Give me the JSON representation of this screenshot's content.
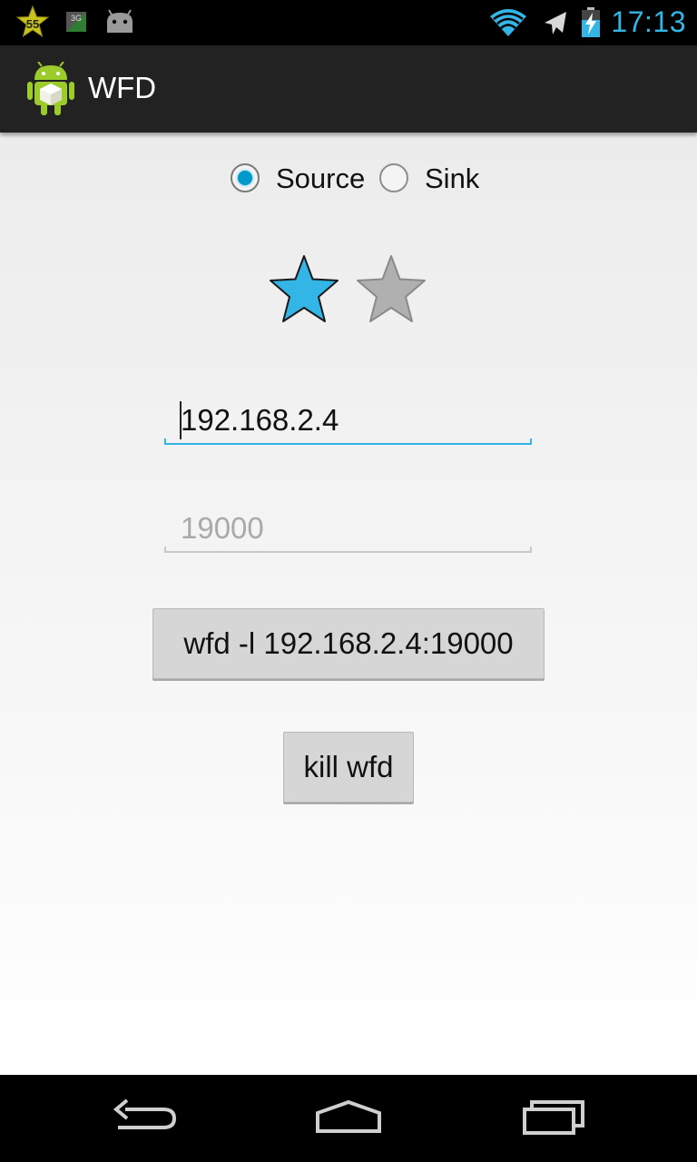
{
  "status_bar": {
    "time": "17:13",
    "badge_count": "55",
    "icons": [
      "notification-star-icon",
      "3g-icon",
      "android-debug-icon",
      "wifi-icon",
      "airplane-mode-icon",
      "battery-charging-icon"
    ],
    "network_label": "3G"
  },
  "action_bar": {
    "title": "WFD",
    "icon": "android-app-icon"
  },
  "mode": {
    "options": [
      {
        "label": "Source",
        "selected": true
      },
      {
        "label": "Sink",
        "selected": false
      }
    ]
  },
  "rating": {
    "value": 1,
    "max": 2
  },
  "ip_field": {
    "value": "192.168.2.4",
    "focused": true
  },
  "port_field": {
    "placeholder": "19000"
  },
  "buttons": {
    "run_label": "wfd -l 192.168.2.4:19000",
    "kill_label": "kill wfd"
  },
  "nav_bar": {
    "icons": [
      "back-icon",
      "home-icon",
      "recent-apps-icon"
    ]
  },
  "colors": {
    "accent": "#33b5e5",
    "star_filled": "#33b5e5",
    "star_empty": "#b0b0b0"
  }
}
